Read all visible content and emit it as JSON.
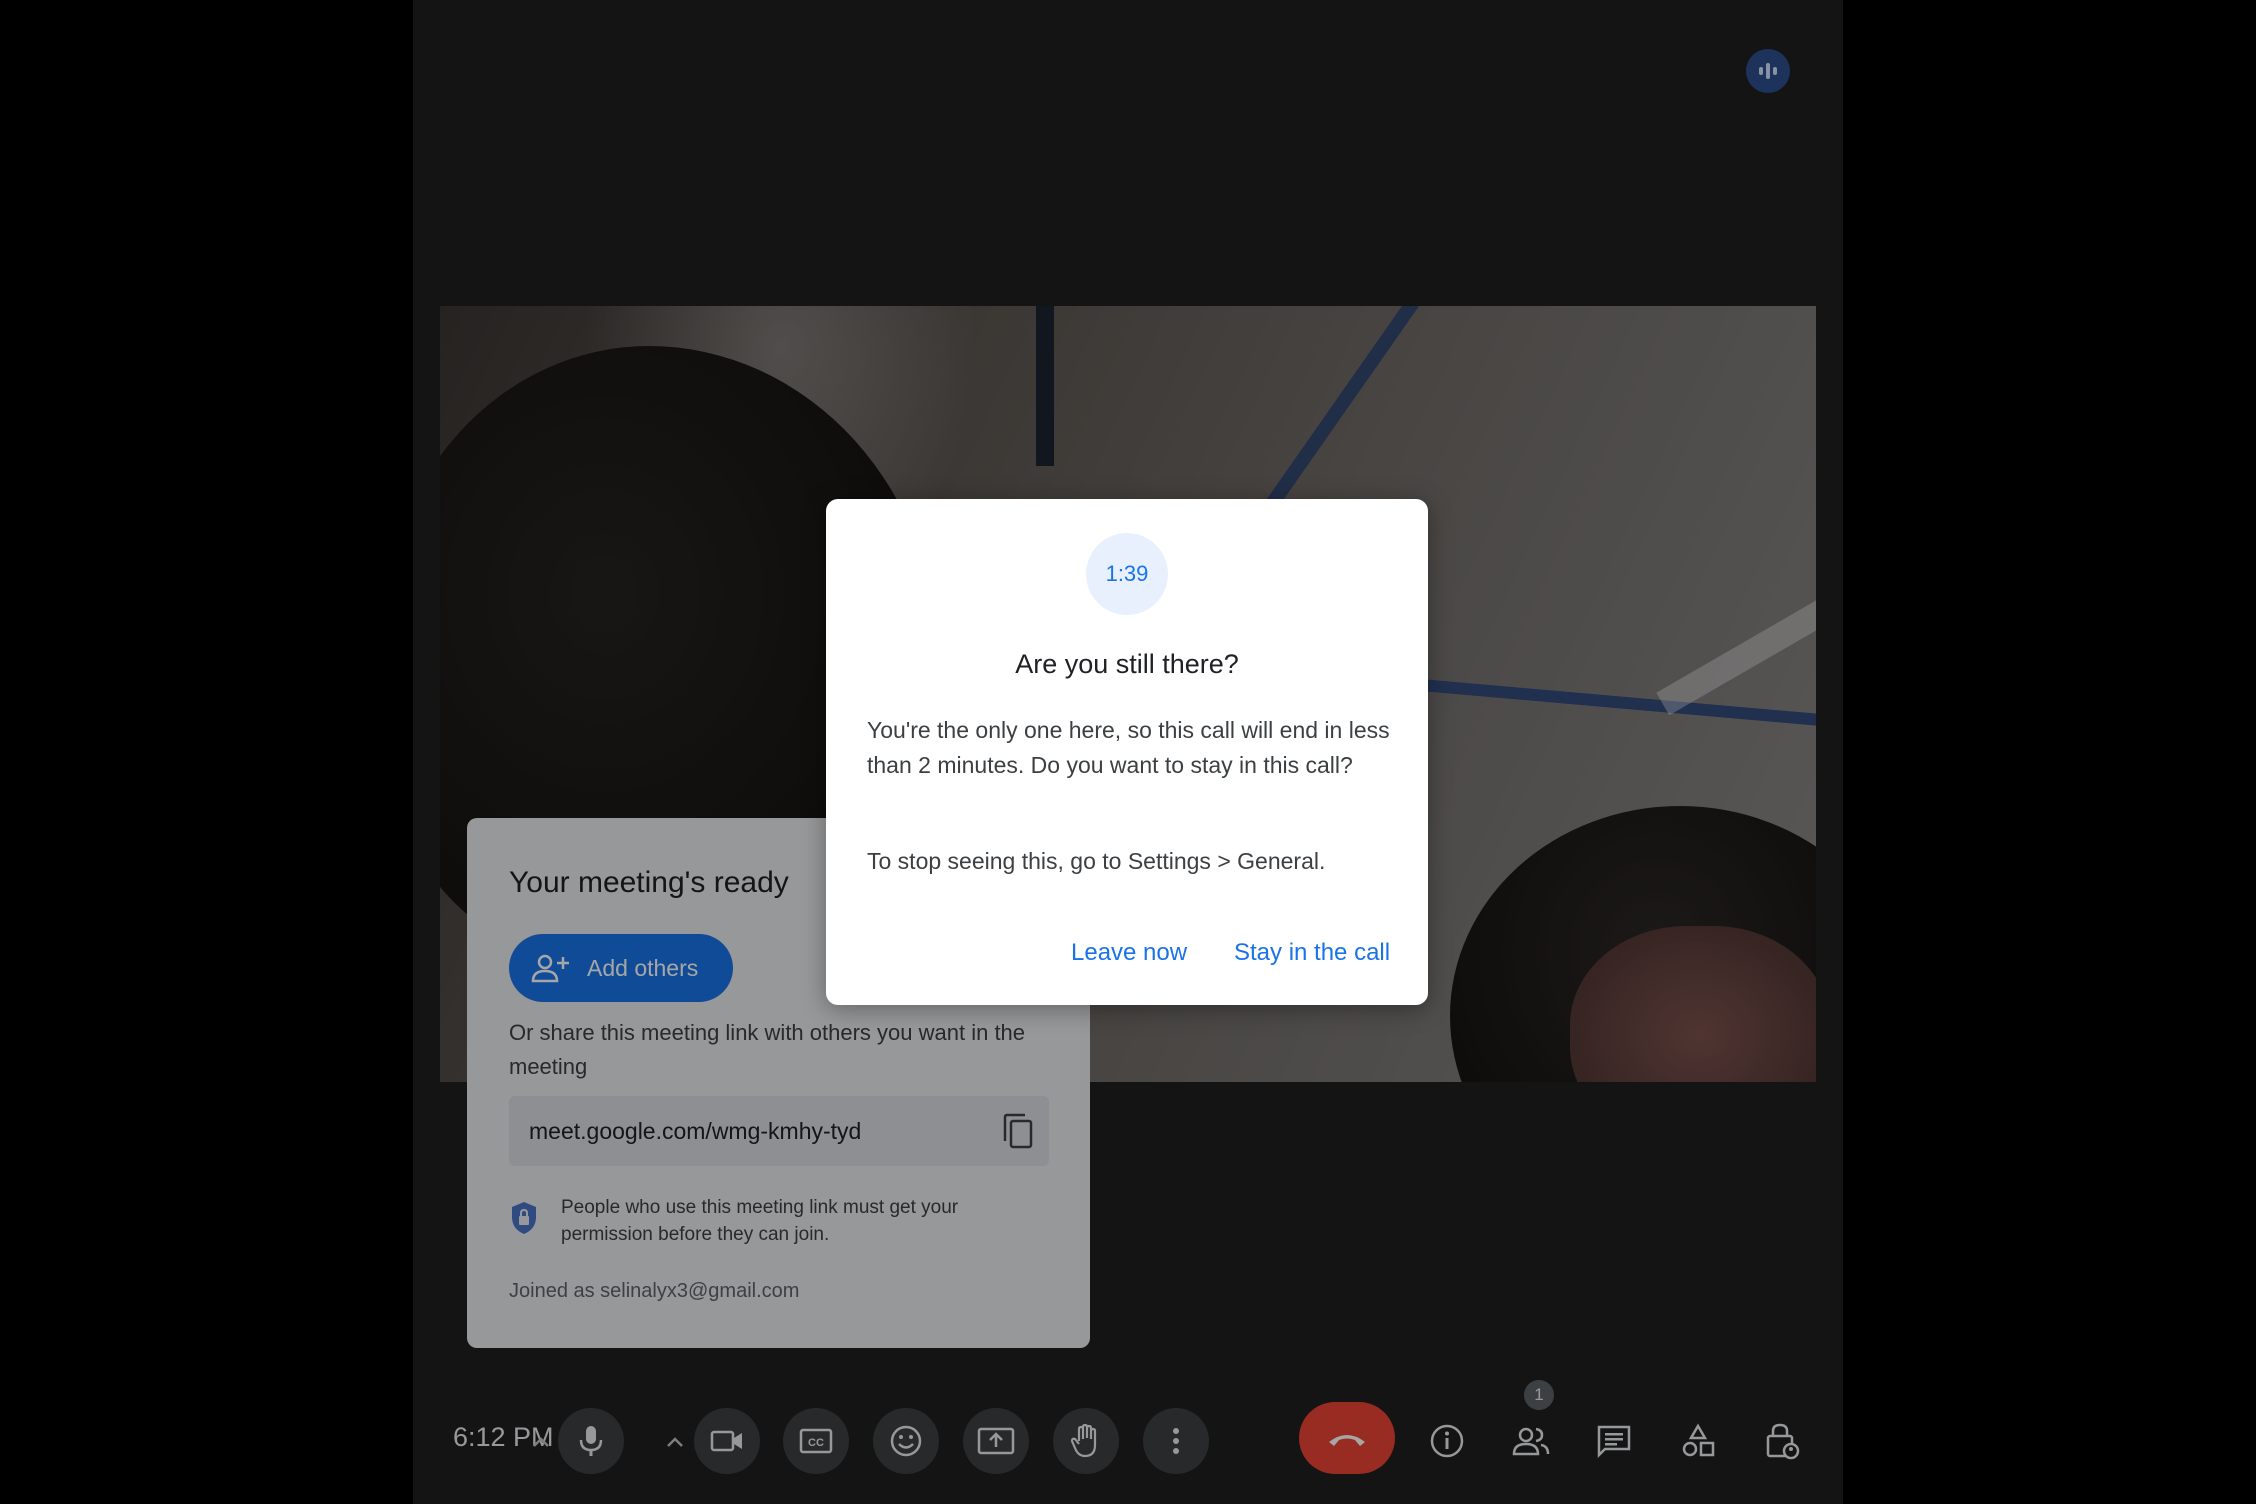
{
  "dialog": {
    "countdown": "1:39",
    "title": "Are you still there?",
    "body": "You're the only one here, so this call will end in less than 2 minutes. Do you want to stay in this call?",
    "tip": "To stop seeing this, go to Settings > General.",
    "leave_label": "Leave now",
    "stay_label": "Stay in the call"
  },
  "ready_card": {
    "title": "Your meeting's ready",
    "add_others_label": "Add others",
    "share_text": "Or share this meeting link with others you want in the meeting",
    "meeting_link": "meet.google.com/wmg-kmhy-tyd",
    "permission_text": "People who use this meeting link must get your permission before they can join.",
    "joined_as": "Joined as selinalyx3@gmail.com"
  },
  "controls": {
    "time": "6:12 PM",
    "people_count": "1",
    "icons": [
      "audio-options-caret",
      "microphone",
      "video-options-caret",
      "camera",
      "captions",
      "emoji",
      "present-screen",
      "raise-hand",
      "more-options",
      "leave-call",
      "meeting-info",
      "people",
      "chat",
      "activities",
      "host-controls"
    ]
  },
  "colors": {
    "accent": "#1a73e8",
    "leave_red": "#ea4335",
    "stage_bg": "#1f1f1f"
  }
}
